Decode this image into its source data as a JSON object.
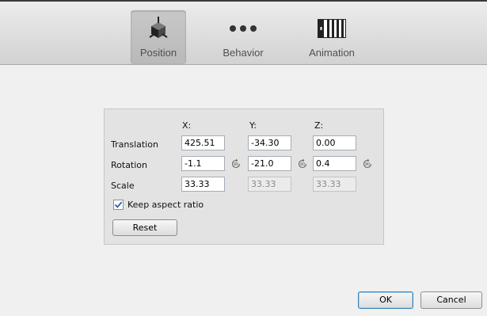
{
  "toolbar": {
    "tabs": [
      {
        "label": "Position",
        "icon": "position-icon",
        "active": true
      },
      {
        "label": "Behavior",
        "icon": "behavior-icon",
        "active": false
      },
      {
        "label": "Animation",
        "icon": "animation-icon",
        "active": false
      }
    ]
  },
  "transform": {
    "columns": {
      "x": "X:",
      "y": "Y:",
      "z": "Z:"
    },
    "translation": {
      "label": "Translation",
      "x": "425.51",
      "y": "-34.30",
      "z": "0.00"
    },
    "rotation": {
      "label": "Rotation",
      "x": "-1.1",
      "y": "-21.0",
      "z": "0.4",
      "rotate_icon": "rotate-90-icon"
    },
    "scale": {
      "label": "Scale",
      "x": "33.33",
      "y": "33.33",
      "z": "33.33",
      "y_enabled": false,
      "z_enabled": false
    },
    "keep_aspect": {
      "label": "Keep aspect ratio",
      "checked": true
    },
    "reset_label": "Reset"
  },
  "footer": {
    "ok_label": "OK",
    "cancel_label": "Cancel"
  },
  "colors": {
    "default_button_border": "#3c7fb1",
    "checkmark": "#2a5fa8"
  }
}
